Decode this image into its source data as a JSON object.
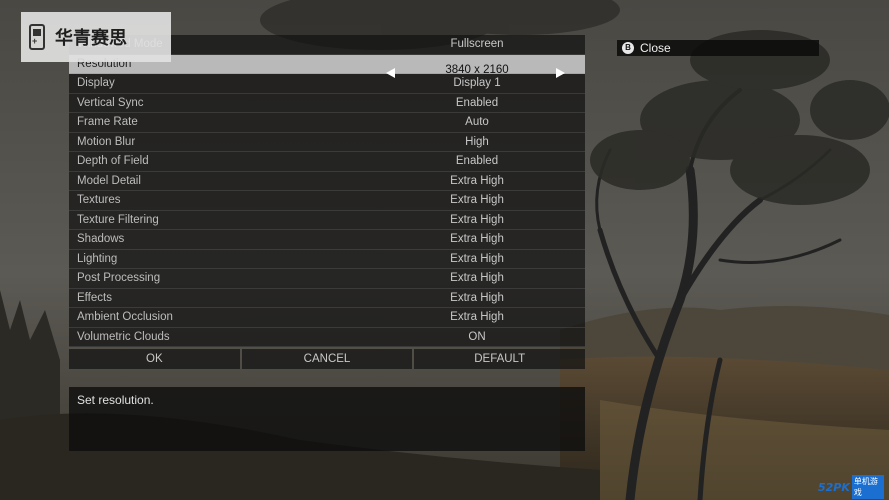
{
  "watermark": {
    "text": "华青赛思"
  },
  "settings": [
    {
      "label": "Windowed Mode",
      "value": "Fullscreen"
    },
    {
      "label": "Resolution",
      "value": "3840 x 2160"
    },
    {
      "label": "Display",
      "value": "Display 1"
    },
    {
      "label": "Vertical Sync",
      "value": "Enabled"
    },
    {
      "label": "Frame Rate",
      "value": "Auto"
    },
    {
      "label": "Motion Blur",
      "value": "High"
    },
    {
      "label": "Depth of Field",
      "value": "Enabled"
    },
    {
      "label": "Model Detail",
      "value": "Extra High"
    },
    {
      "label": "Textures",
      "value": "Extra High"
    },
    {
      "label": "Texture Filtering",
      "value": "Extra High"
    },
    {
      "label": "Shadows",
      "value": "Extra High"
    },
    {
      "label": "Lighting",
      "value": "Extra High"
    },
    {
      "label": "Post Processing",
      "value": "Extra High"
    },
    {
      "label": "Effects",
      "value": "Extra High"
    },
    {
      "label": "Ambient Occlusion",
      "value": "Extra High"
    },
    {
      "label": "Volumetric Clouds",
      "value": "ON"
    }
  ],
  "selected_index": 1,
  "buttons": {
    "ok": "OK",
    "cancel": "CANCEL",
    "default": "DEFAULT"
  },
  "description": "Set resolution.",
  "close": {
    "button_glyph": "B",
    "label": "Close"
  },
  "logo": {
    "number": "52PK",
    "text": "单机游戏"
  },
  "colors": {
    "selected_row": "#b9b9b9",
    "panel": "#121212",
    "logo_blue": "#1a6fd0"
  }
}
